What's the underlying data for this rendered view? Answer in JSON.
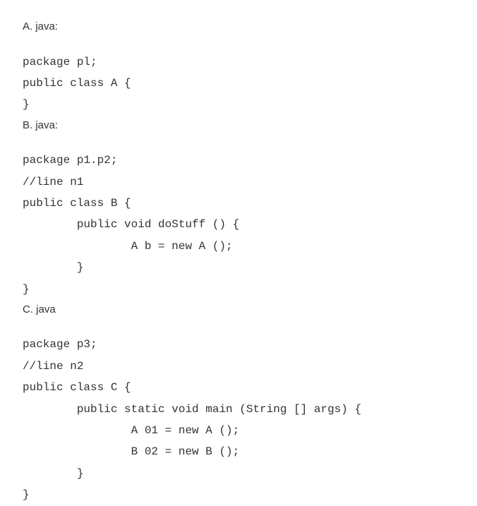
{
  "section_a": {
    "label": "A. java:",
    "code": "package pl;\npublic class A {\n}"
  },
  "section_b": {
    "label": "B. java:",
    "code": "package p1.p2;\n//line n1\npublic class B {\n        public void doStuff () {\n                A b = new A ();\n        }\n}"
  },
  "section_c": {
    "label": "C. java",
    "code": "package p3;\n//line n2\npublic class C {\n        public static void main (String [] args) {\n                A 01 = new A ();\n                B 02 = new B ();\n        }\n}"
  }
}
